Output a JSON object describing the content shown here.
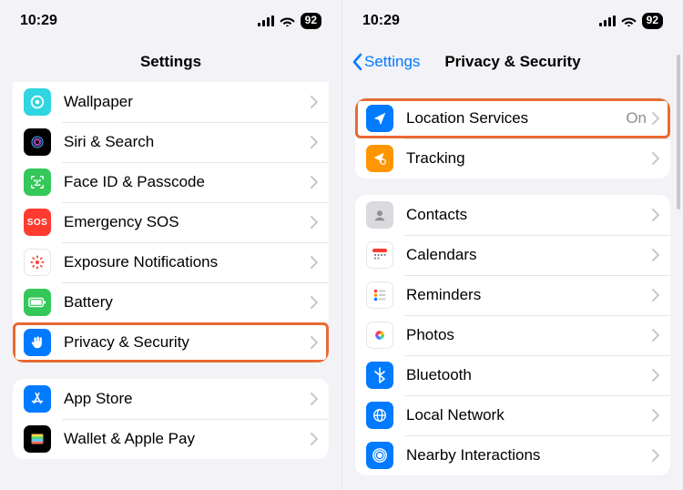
{
  "status": {
    "time": "10:29",
    "battery": "92"
  },
  "left": {
    "title": "Settings",
    "group1": {
      "wallpaper": "Wallpaper",
      "siri": "Siri & Search",
      "faceid": "Face ID & Passcode",
      "sos": "Emergency SOS",
      "exposure": "Exposure Notifications",
      "battery": "Battery",
      "privacy": "Privacy & Security"
    },
    "group2": {
      "appstore": "App Store",
      "wallet": "Wallet & Apple Pay"
    },
    "sos_text": "SOS"
  },
  "right": {
    "back": "Settings",
    "title": "Privacy & Security",
    "group1": {
      "location": "Location Services",
      "location_status": "On",
      "tracking": "Tracking"
    },
    "group2": {
      "contacts": "Contacts",
      "calendars": "Calendars",
      "reminders": "Reminders",
      "photos": "Photos",
      "bluetooth": "Bluetooth",
      "localnet": "Local Network",
      "nearby": "Nearby Interactions"
    }
  }
}
